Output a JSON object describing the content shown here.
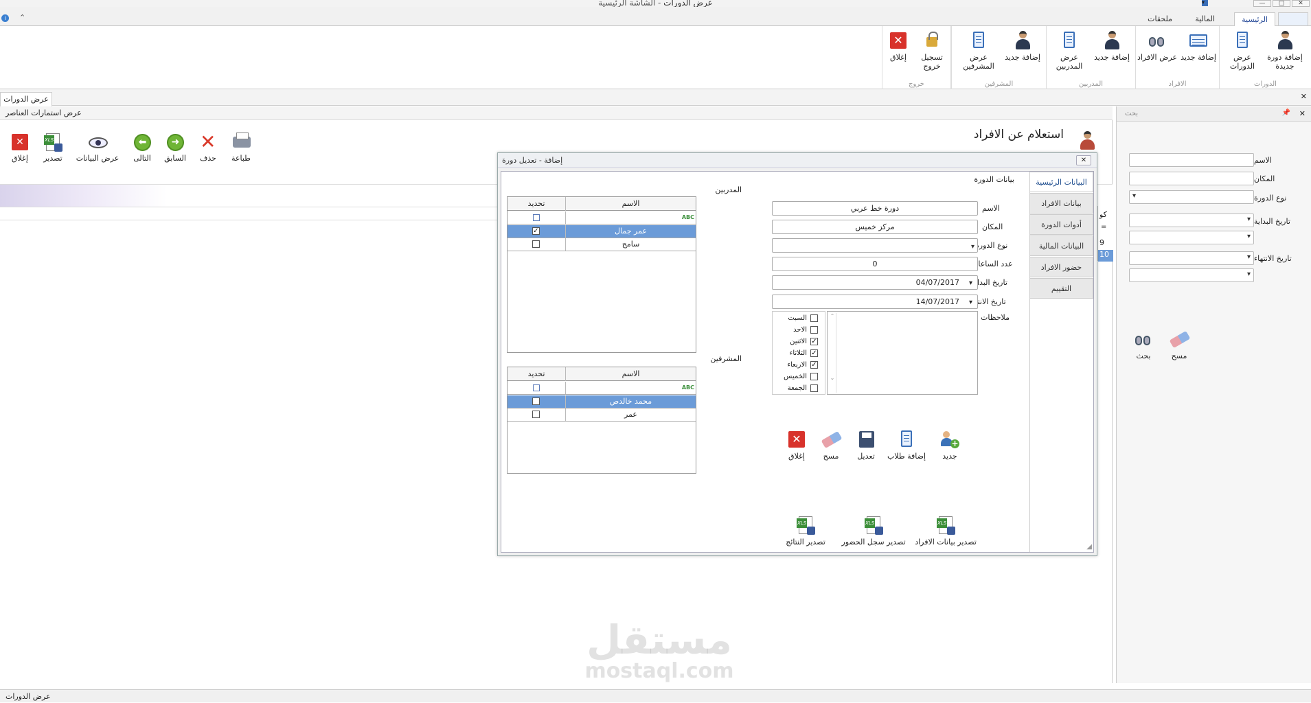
{
  "window": {
    "title": "عرض الدورات",
    "subtitle": "الشاشة الرئيسية"
  },
  "ribbon_tabs": [
    "الرئيسية",
    "المالية",
    "ملحقات"
  ],
  "ribbon_groups": [
    {
      "label": "الدورات",
      "buttons": [
        "إضافة دورة جديدة",
        "عرض الدورات"
      ]
    },
    {
      "label": "الافراد",
      "buttons": [
        "إضافة جديد",
        "عرض الافراد"
      ]
    },
    {
      "label": "المدربين",
      "buttons": [
        "إضافة جديد",
        "عرض المدربين"
      ]
    },
    {
      "label": "المشرفين",
      "buttons": [
        "إضافة جديد",
        "عرض المشرفين"
      ]
    },
    {
      "label": "خروج",
      "buttons": [
        "تسجيل خروج",
        "إغلاق"
      ]
    }
  ],
  "doc_tab": "عرض الدورات",
  "subheader": "عرض استمارات العناصر",
  "page_title": "استعلام عن الافراد",
  "toolbar": {
    "print": "طباعة",
    "delete": "حذف",
    "previous": "السابق",
    "next": "التالى",
    "view": "عرض البيانات",
    "export": "تصدير",
    "close": "إغلاق"
  },
  "grid_partial": {
    "header": "كو",
    "rows": [
      "9",
      "10"
    ]
  },
  "search_panel": {
    "title": "بحث",
    "name_label": "الاسم",
    "place_label": "المكان",
    "type_label": "نوع الدورة",
    "start_label": "تاريخ البداية",
    "end_label": "تاريخ الانتهاء",
    "search_btn": "بحث",
    "clear_btn": "مسح"
  },
  "dialog": {
    "title": "إضافة - تعديل دورة",
    "section": "بيانات الدورة",
    "tabs": [
      "البيانات الرئيسية",
      "بيانات الافراد",
      "أدوات الدورة",
      "البيانات المالية",
      "حضور الافراد",
      "التقييم"
    ],
    "labels": {
      "name": "الاسم",
      "place": "المكان",
      "type": "نوع الدورة",
      "hours": "عدد الساعات",
      "start": "تاريخ البداية",
      "end": "تاريخ الانتهاء",
      "notes": "ملاحظات"
    },
    "values": {
      "name": "دورة خط عربي",
      "place": "مركز خميس",
      "type": "",
      "hours": "0",
      "start": "04/07/2017",
      "end": "14/07/2017"
    },
    "days": [
      {
        "label": "السبت",
        "checked": false
      },
      {
        "label": "الاحد",
        "checked": false
      },
      {
        "label": "الاثنين",
        "checked": true
      },
      {
        "label": "الثلاثاء",
        "checked": true
      },
      {
        "label": "الاربعاء",
        "checked": true
      },
      {
        "label": "الخميس",
        "checked": false
      },
      {
        "label": "الجمعة",
        "checked": false
      }
    ],
    "trainers": {
      "title": "المدربين",
      "col_name": "الاسم",
      "col_select": "تحديد",
      "rows": [
        {
          "name": "عمر جمال",
          "checked": true,
          "selected": true
        },
        {
          "name": "سامح",
          "checked": false,
          "selected": false
        }
      ]
    },
    "supervisors": {
      "title": "المشرفين",
      "col_name": "الاسم",
      "col_select": "تحديد",
      "rows": [
        {
          "name": "محمد خالدص",
          "checked": false,
          "selected": true
        },
        {
          "name": "عمر",
          "checked": false,
          "selected": false
        }
      ]
    },
    "actions": {
      "new": "جديد",
      "add_students": "إضافة طلاب",
      "edit": "تعديل",
      "clear": "مسح",
      "close": "إغلاق"
    },
    "exports": {
      "members": "تصدير بيانات الافراد",
      "attendance": "تصدير سجل الحضور",
      "results": "تصدير النتائج"
    }
  },
  "statusbar": "عرض الدورات",
  "watermark": {
    "ar": "مستقل",
    "en": "mostaql.com"
  }
}
